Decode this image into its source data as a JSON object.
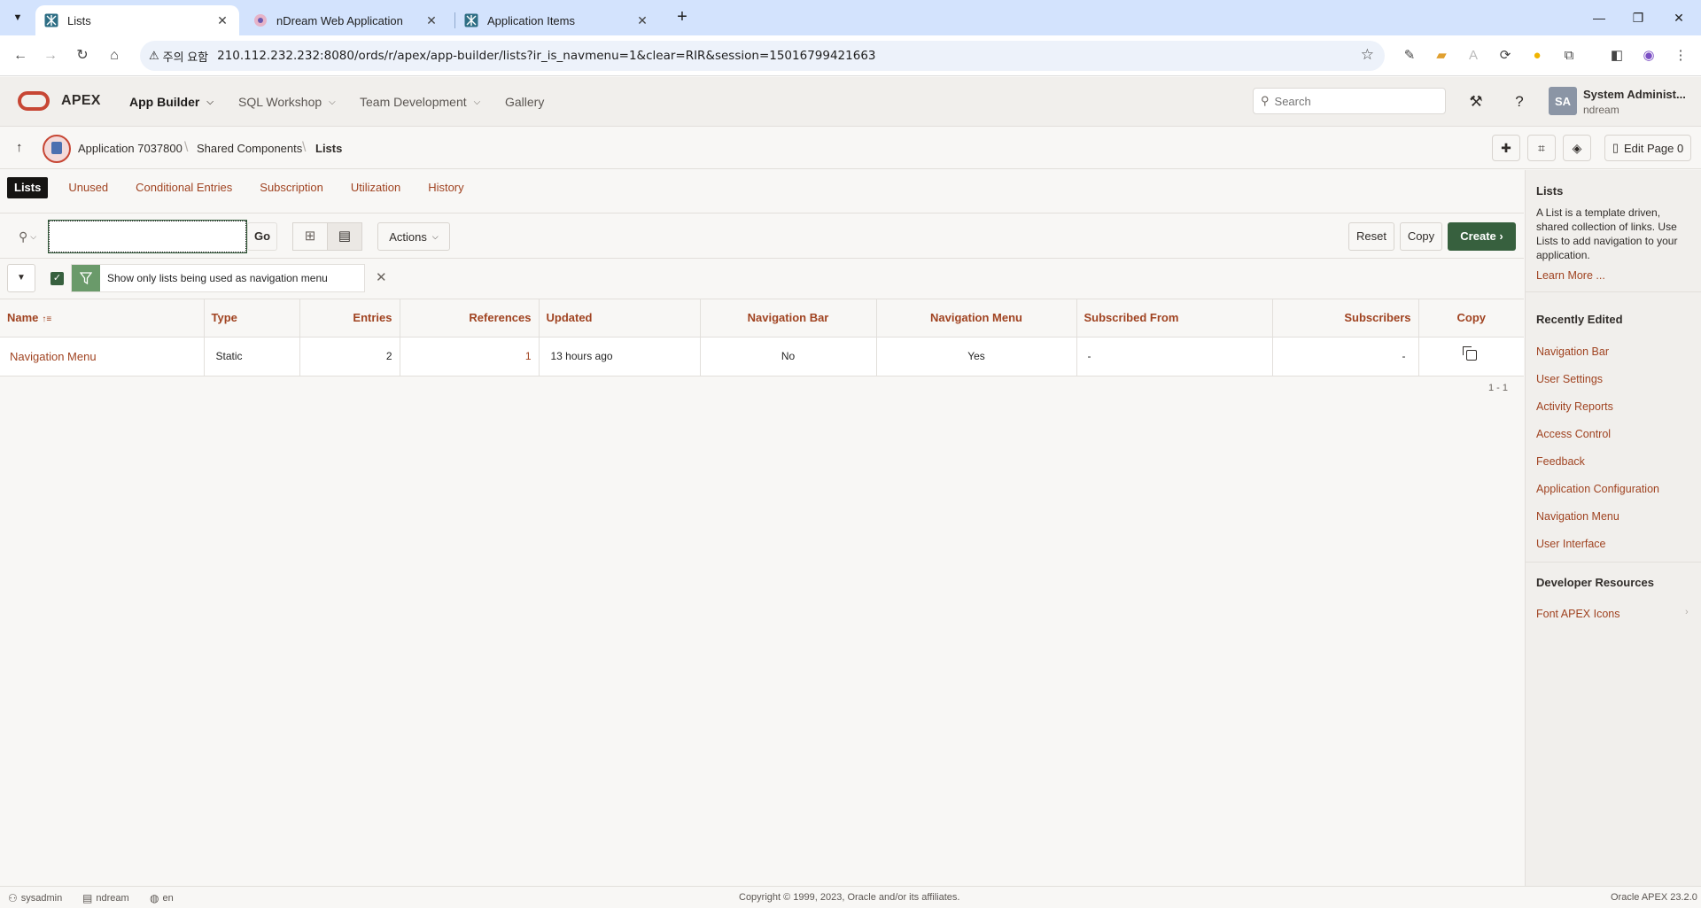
{
  "browser": {
    "tabs": [
      {
        "title": "Lists",
        "active": true
      },
      {
        "title": "nDream Web Application",
        "active": false
      },
      {
        "title": "Application Items",
        "active": false
      }
    ],
    "security_chip": "주의 요함",
    "url": "210.112.232.232:8080/ords/r/apex/app-builder/lists?ir_is_navmenu=1&clear=RIR&session=15016799421663"
  },
  "header": {
    "product": "APEX",
    "nav": [
      {
        "label": "App Builder",
        "active": true
      },
      {
        "label": "SQL Workshop",
        "active": false
      },
      {
        "label": "Team Development",
        "active": false
      },
      {
        "label": "Gallery",
        "active": false
      }
    ],
    "search_placeholder": "Search",
    "user": {
      "initials": "SA",
      "name": "System Administ...",
      "workspace": "ndream"
    }
  },
  "breadcrumb": {
    "items": [
      "Application 7037800",
      "Shared Components",
      "Lists"
    ],
    "edit_page_label": "Edit Page 0"
  },
  "subtabs": [
    "Lists",
    "Unused",
    "Conditional Entries",
    "Subscription",
    "Utilization",
    "History"
  ],
  "toolbar": {
    "go_label": "Go",
    "actions_label": "Actions",
    "reset_label": "Reset",
    "copy_label": "Copy",
    "create_label": "Create"
  },
  "filter": {
    "text": "Show only lists being used as navigation menu",
    "checked": true
  },
  "table": {
    "columns": [
      "Name",
      "Type",
      "Entries",
      "References",
      "Updated",
      "Navigation Bar",
      "Navigation Menu",
      "Subscribed From",
      "Subscribers",
      "Copy"
    ],
    "rows": [
      {
        "name": "Navigation Menu",
        "type": "Static",
        "entries": "2",
        "references": "1",
        "updated": "13 hours ago",
        "nav_bar": "No",
        "nav_menu": "Yes",
        "subscribed_from": "-",
        "subscribers": "-"
      }
    ],
    "pagination": "1 - 1"
  },
  "sidebar": {
    "title": "Lists",
    "description": "A List is a template driven, shared collection of links. Use Lists to add navigation to your application.",
    "learn_more": "Learn More ...",
    "recent_title": "Recently Edited",
    "recent": [
      "Navigation Bar",
      "User Settings",
      "Activity Reports",
      "Access Control",
      "Feedback",
      "Application Configuration",
      "Navigation Menu",
      "User Interface"
    ],
    "dev_title": "Developer Resources",
    "dev_links": [
      "Font APEX Icons"
    ]
  },
  "footer": {
    "user": "sysadmin",
    "workspace": "ndream",
    "language": "en",
    "copyright": "Copyright © 1999, 2023, Oracle and/or its affiliates.",
    "version": "Oracle APEX 23.2.0"
  },
  "colors": {
    "accent": "#a04321",
    "create": "#37603e",
    "brand_red": "#c74634"
  }
}
